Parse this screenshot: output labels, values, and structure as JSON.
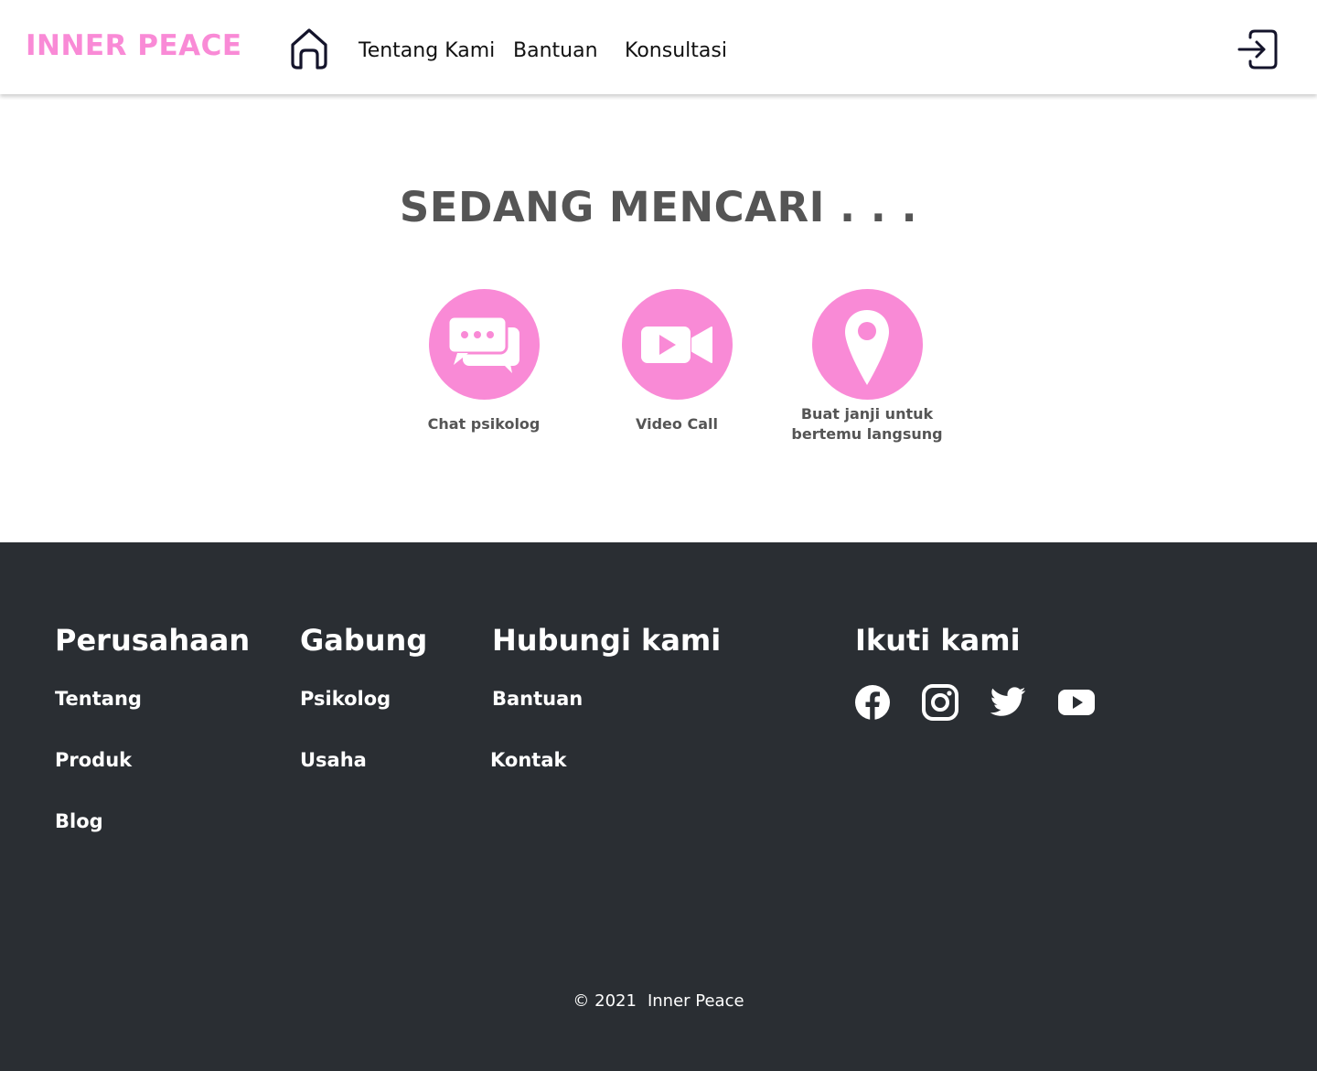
{
  "header": {
    "logo": "INNER PEACE",
    "nav": [
      "Tentang Kami",
      "Bantuan",
      "Konsultasi"
    ],
    "icons": {
      "home": "home-icon",
      "login": "login-icon"
    }
  },
  "main": {
    "title": "SEDANG MENCARI . . .",
    "options": [
      {
        "label": "Chat psikolog",
        "icon": "chat-bubbles-icon"
      },
      {
        "label": "Video Call",
        "icon": "video-camera-icon"
      },
      {
        "label_lines": [
          "Buat janji untuk",
          "bertemu langsung"
        ],
        "icon": "location-pin-icon"
      }
    ]
  },
  "footer": {
    "columns": [
      {
        "title": "Perusahaan",
        "links": [
          "Tentang",
          "Produk",
          "Blog"
        ]
      },
      {
        "title": "Gabung",
        "links": [
          "Psikolog",
          "Usaha"
        ]
      },
      {
        "title": "Hubungi kami",
        "links": [
          "Bantuan",
          "Kontak"
        ]
      }
    ],
    "social": {
      "title": "Ikuti kami",
      "icons": [
        "facebook-icon",
        "instagram-icon",
        "twitter-icon",
        "youtube-icon"
      ]
    },
    "copyright": {
      "symbol_year": "© 2021",
      "name": "Inner Peace"
    }
  },
  "colors": {
    "accent": "#f98ad6",
    "footer_bg": "#2a2e33",
    "heading_text": "#555555"
  }
}
